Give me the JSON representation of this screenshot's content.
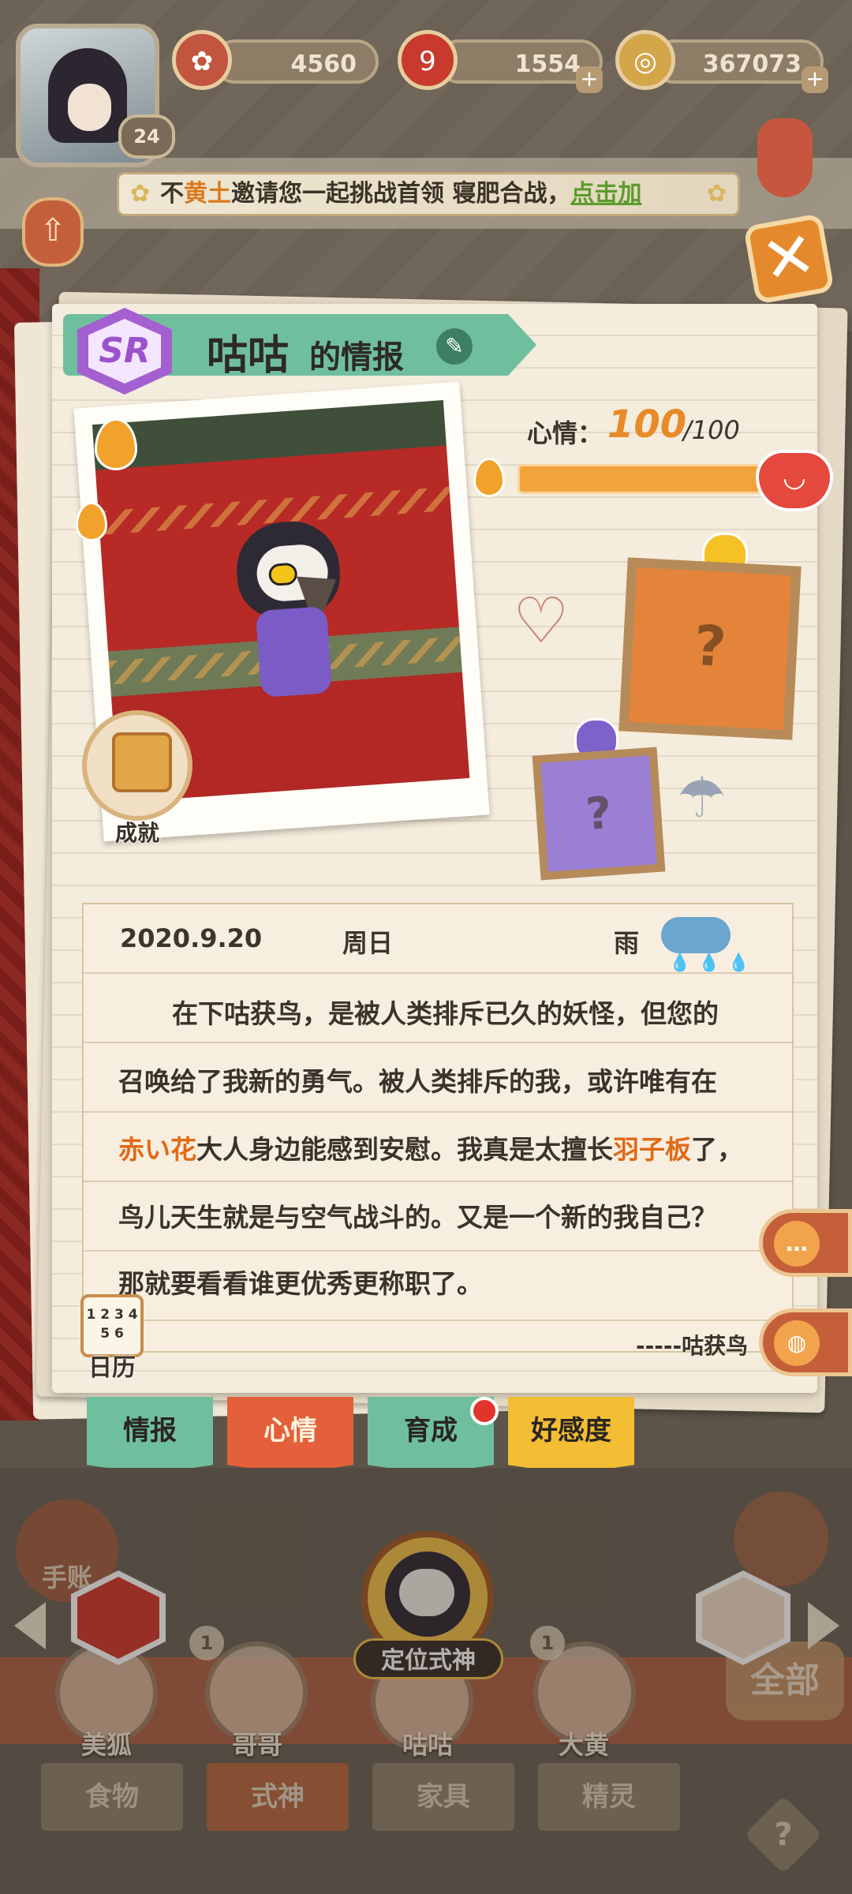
{
  "player": {
    "level": "24"
  },
  "currencies": [
    {
      "name": "plum-coupon",
      "value": "4560",
      "icon": "plum-icon"
    },
    {
      "name": "magatama",
      "value": "1554",
      "icon": "magatama-icon"
    },
    {
      "name": "coins",
      "value": "367073",
      "icon": "coin-icon"
    }
  ],
  "invite": {
    "prefix": "不",
    "inviter": "黄土",
    "message": "邀请您一起挑战首领 寝肥合战，",
    "join_label": "点击加"
  },
  "profile": {
    "rarity": "SR",
    "name": "咕咕",
    "title_suffix": "的情报",
    "achievement_label": "成就"
  },
  "mood": {
    "label": "心情：",
    "value": "100",
    "max": "/100",
    "level": 1.0
  },
  "diary": {
    "date": "2020.9.20",
    "weekday": "周日",
    "weather": "雨",
    "lines": [
      "在下咕获鸟，是被人类排斥已久的妖怪，但您的",
      "召唤给了我新的勇气。被人类排斥的我，或许唯有在",
      "大人身边能感到安慰。我真是太擅长",
      "鸟儿天生就是与空气战斗的。又是一个新的我自己？",
      "那就要看看谁更优秀更称职了。"
    ],
    "highlight_1": "赤い花",
    "highlight_2": "羽子板",
    "line3_end": "了，",
    "signature": "-----咕获鸟",
    "calendar_label": "日历",
    "calendar_digits": "1 2 3 4 5 6"
  },
  "tabs": [
    {
      "label": "情报"
    },
    {
      "label": "心情"
    },
    {
      "label": "育成"
    },
    {
      "label": "好感度"
    }
  ],
  "bottom": {
    "handbook_label": "手账",
    "locate_label": "定位式神",
    "all_label": "全部",
    "characters": [
      {
        "name": "美狐"
      },
      {
        "name": "哥哥",
        "level": "1"
      },
      {
        "name": "咕咕"
      },
      {
        "name": "大黄",
        "level": "1"
      }
    ],
    "categories": [
      {
        "label": "食物"
      },
      {
        "label": "式神"
      },
      {
        "label": "家具"
      },
      {
        "label": "精灵"
      }
    ],
    "help": "?"
  },
  "colors": {
    "accent_orange": "#e98a2a",
    "tab_green": "#6fbf9e",
    "tab_red": "#e3603a",
    "tab_yellow": "#f3bd34",
    "sr_purple": "#a45fd0"
  }
}
